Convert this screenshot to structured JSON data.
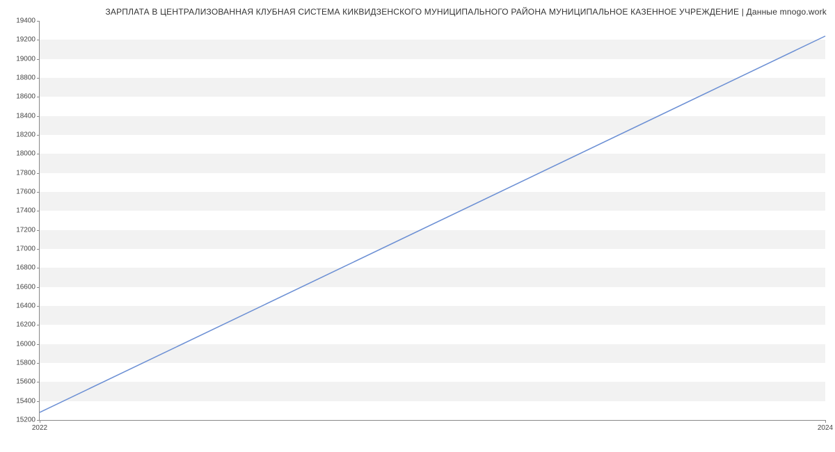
{
  "chart_data": {
    "type": "line",
    "title": "ЗАРПЛАТА В ЦЕНТРАЛИЗОВАННАЯ КЛУБНАЯ СИСТЕМА КИКВИДЗЕНСКОГО МУНИЦИПАЛЬНОГО РАЙОНА МУНИЦИПАЛЬНОЕ КАЗЕННОЕ УЧРЕЖДЕНИЕ | Данные mnogo.work",
    "x": [
      2022,
      2024
    ],
    "values": [
      15280,
      19240
    ],
    "xlabel": "",
    "ylabel": "",
    "xlim": [
      2022,
      2024
    ],
    "ylim": [
      15200,
      19400
    ],
    "x_ticks": [
      2022,
      2024
    ],
    "y_ticks": [
      15200,
      15400,
      15600,
      15800,
      16000,
      16200,
      16400,
      16600,
      16800,
      17000,
      17200,
      17400,
      17600,
      17800,
      18000,
      18200,
      18400,
      18600,
      18800,
      19000,
      19200,
      19400
    ],
    "series_color": "#6b8fd4",
    "grid_band_color": "#f2f2f2"
  }
}
